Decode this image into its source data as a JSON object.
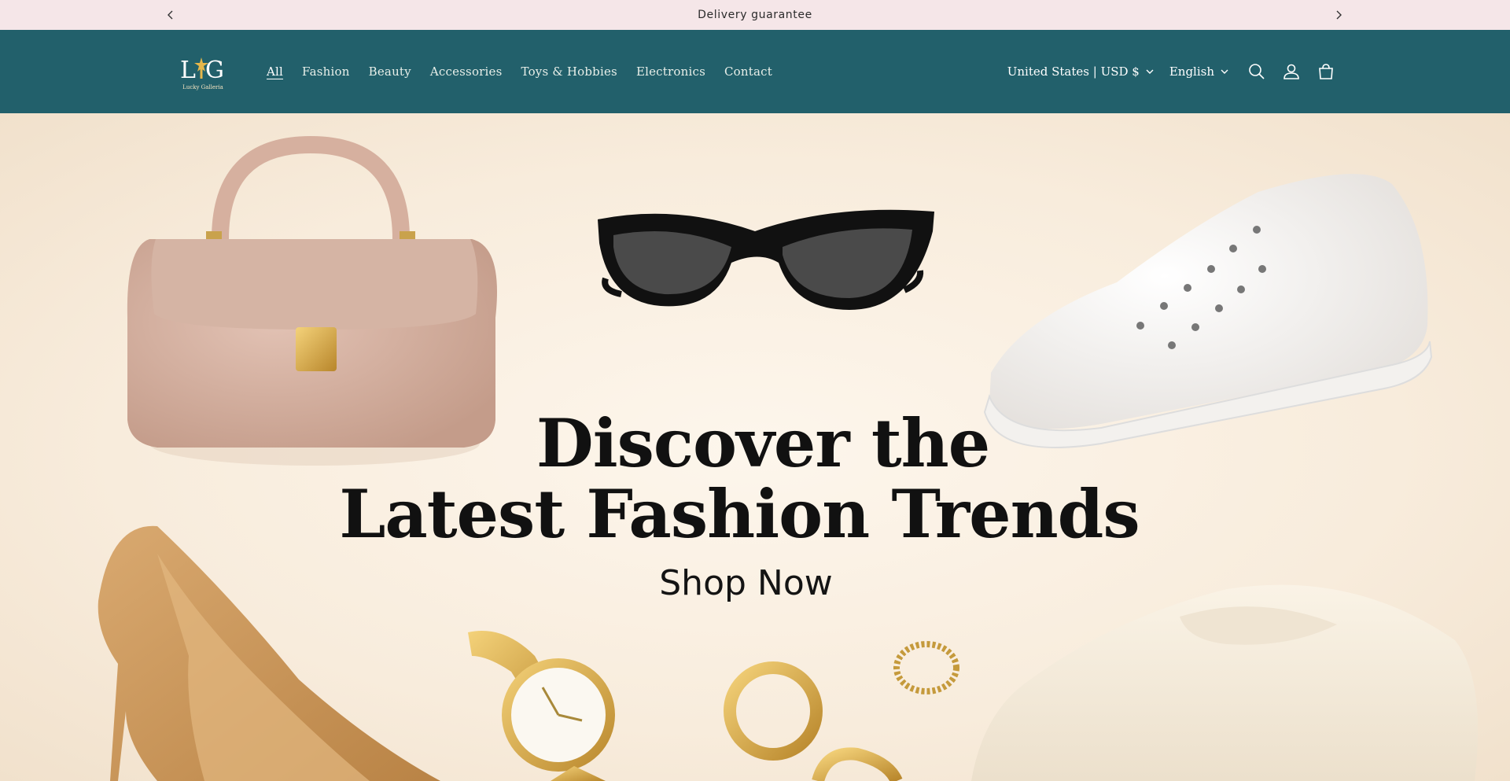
{
  "announcement": {
    "text": "Delivery guarantee"
  },
  "brand": {
    "logo_letters": "LiG",
    "logo_sub": "Lucky Galleria"
  },
  "nav": {
    "items": [
      {
        "label": "All"
      },
      {
        "label": "Fashion"
      },
      {
        "label": "Beauty"
      },
      {
        "label": "Accessories"
      },
      {
        "label": "Toys & Hobbies"
      },
      {
        "label": "Electronics"
      },
      {
        "label": "Contact"
      }
    ]
  },
  "header": {
    "country_currency": "United States | USD $",
    "language": "English",
    "icons": [
      "search-icon",
      "account-icon",
      "cart-icon"
    ]
  },
  "hero": {
    "headline_line1": "Discover the",
    "headline_line2": "Latest Fashion Trends",
    "cta": "Shop Now"
  },
  "colors": {
    "announcement_bg": "#f5e6e8",
    "header_bg": "#22606b",
    "hero_bg": "#fbf3e9"
  }
}
